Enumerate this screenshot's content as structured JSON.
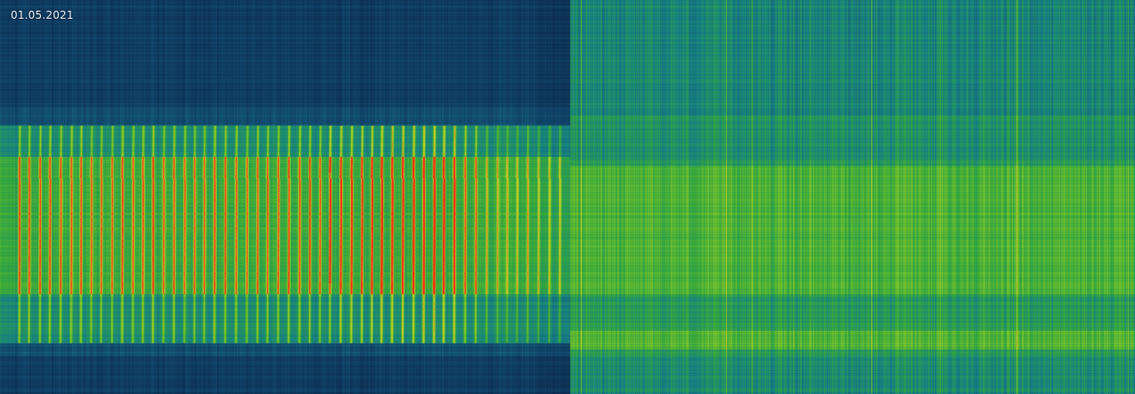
{
  "overlay": {
    "date": "01.05.2021"
  },
  "colors": {
    "background_dark": "#0b2a4a",
    "background_mid": "#14507a",
    "teal": "#1a8a8a",
    "green": "#3cae3c",
    "yellow_green": "#b8d22c",
    "orange": "#e07a1e",
    "red": "#f02814"
  }
}
